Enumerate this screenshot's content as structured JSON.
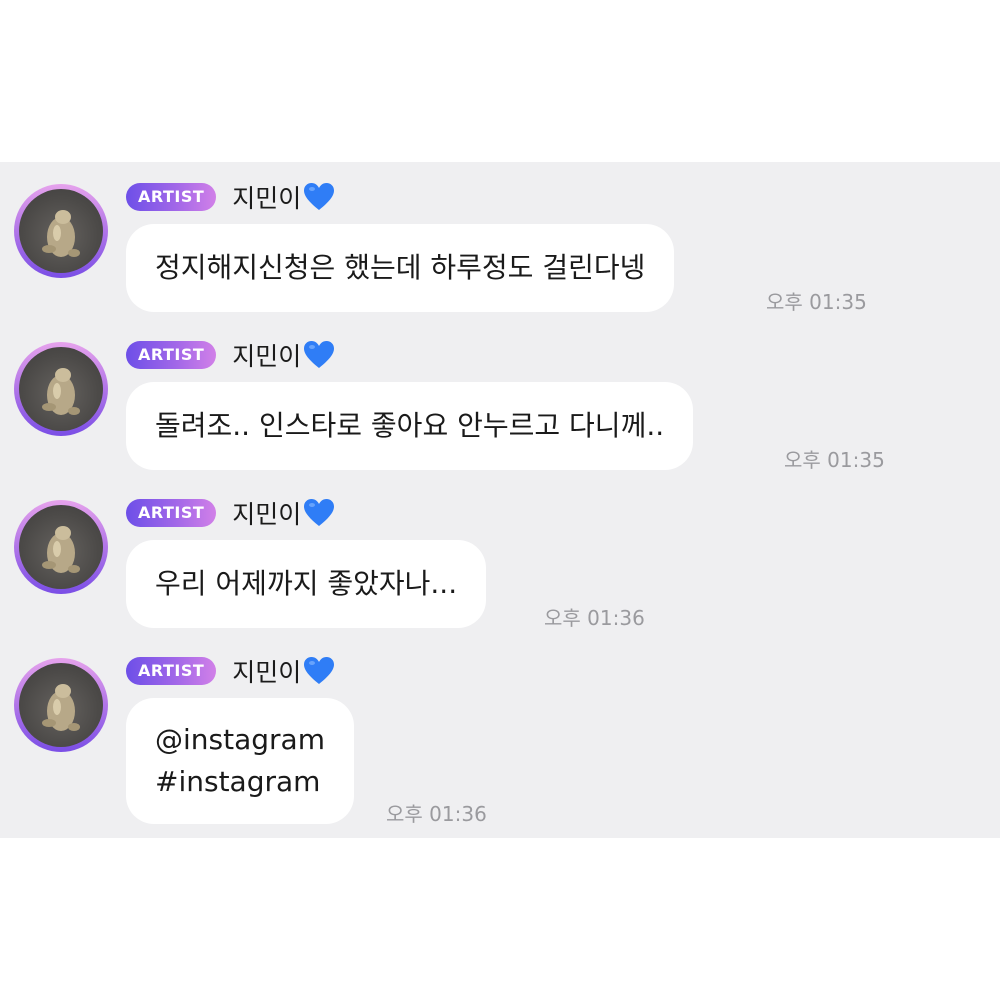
{
  "messages": [
    {
      "badge": "ARTIST",
      "sender": "지민이",
      "text": "정지해지신청은 했는데 하루정도 걸린다넹",
      "time": "오후 01:35"
    },
    {
      "badge": "ARTIST",
      "sender": "지민이",
      "text": "돌려조.. 인스타로 좋아요 안누르고 다니께..",
      "time": "오후 01:35"
    },
    {
      "badge": "ARTIST",
      "sender": "지민이",
      "text": "우리 어제까지 좋았자나...",
      "time": "오후 01:36"
    },
    {
      "badge": "ARTIST",
      "sender": "지민이",
      "lines": [
        "@instagram",
        "#instagram"
      ],
      "time": "오후 01:36"
    }
  ],
  "colors": {
    "panel_bg": "#efeff1",
    "badge_start": "#6d4fe8",
    "badge_end": "#d180e8",
    "heart": "#2f7df6",
    "timestamp": "#9a9a9e"
  },
  "icons": {
    "heart": "blue-heart-icon",
    "avatar": "avatar-photo"
  }
}
